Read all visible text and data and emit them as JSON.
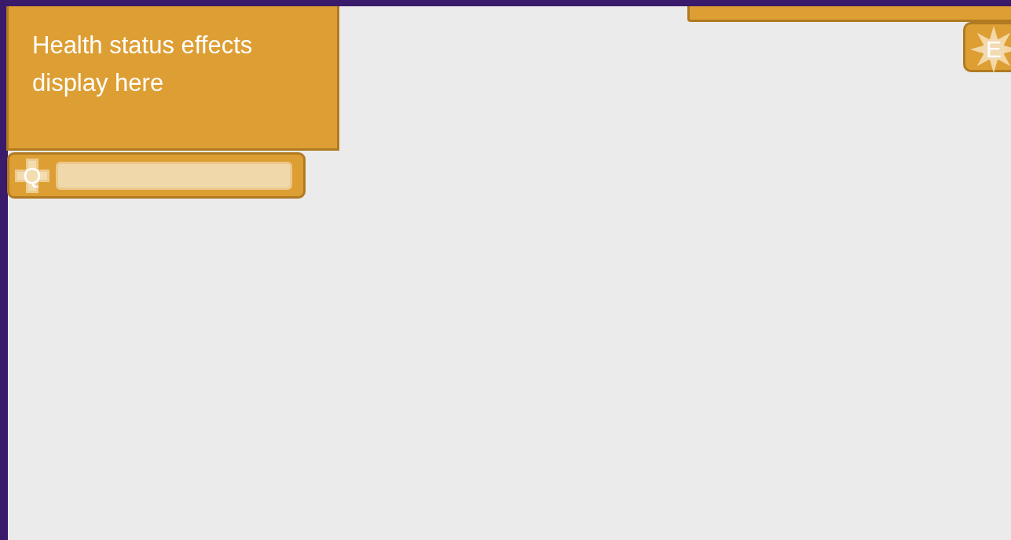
{
  "status_panel": {
    "text": "Health status effects display here"
  },
  "hotkeys": [
    {
      "key": "Q",
      "kind": "cross"
    },
    {
      "key": "E",
      "kind": "sun"
    }
  ]
}
